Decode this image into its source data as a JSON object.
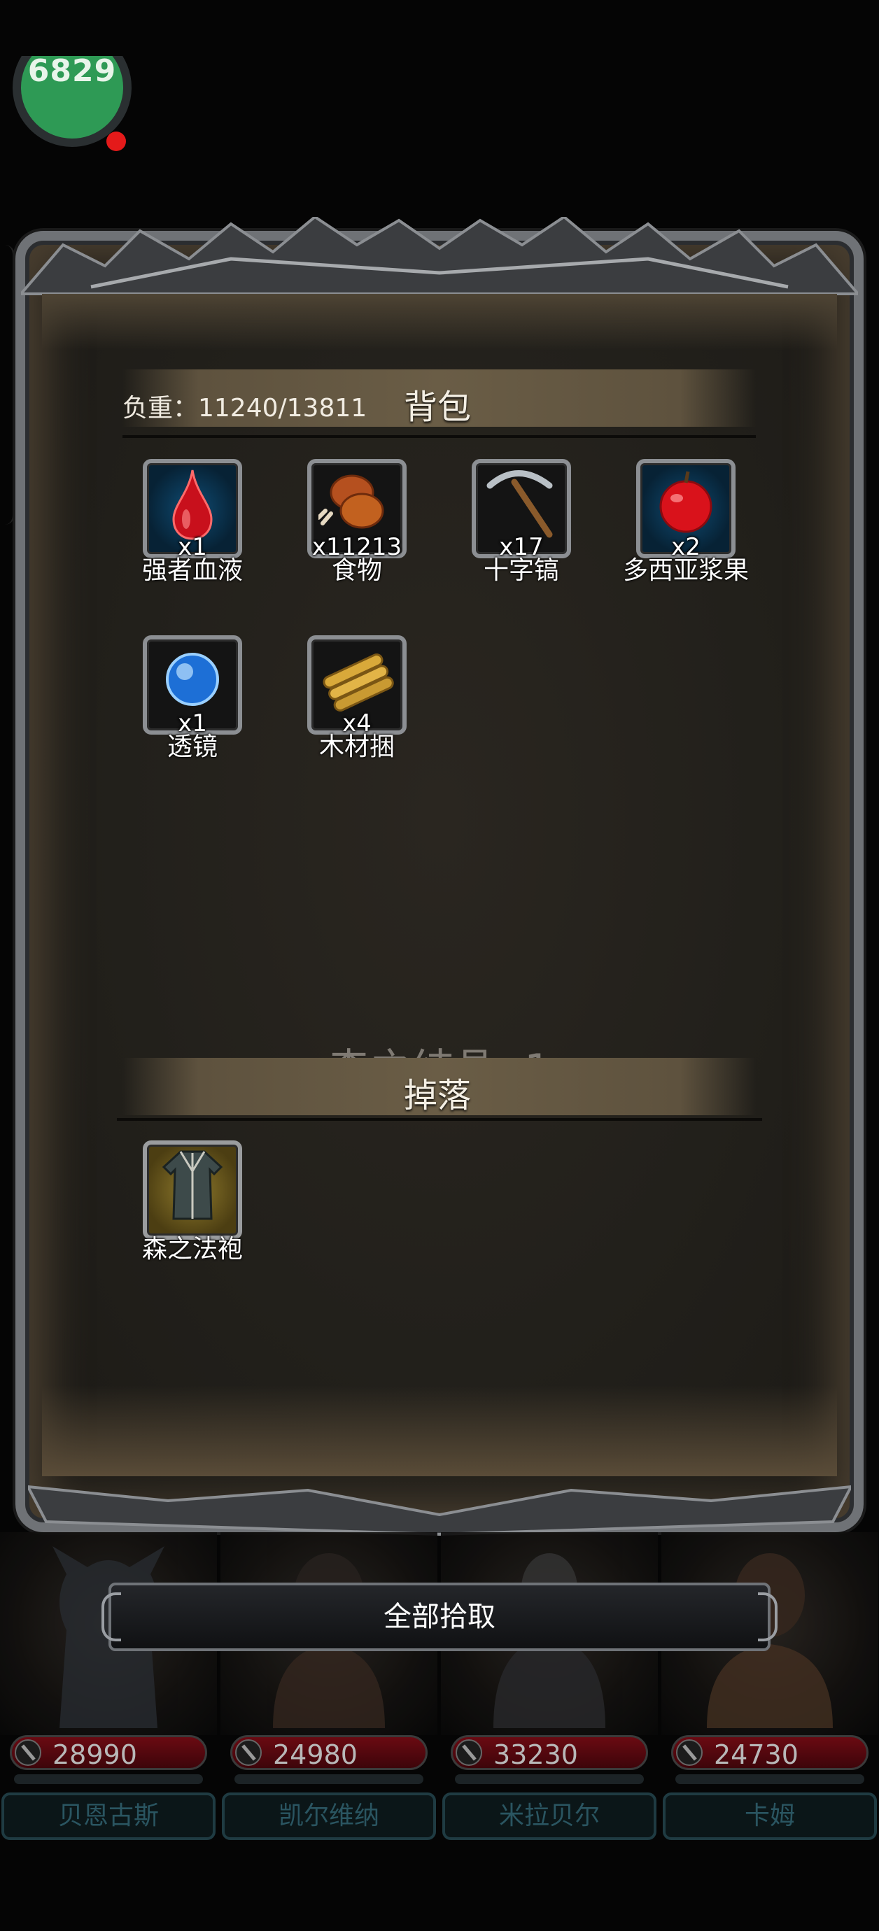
{
  "timer": {
    "value": "6829"
  },
  "inventory": {
    "weight_label": "负重：11240/13811",
    "title": "背包",
    "items": [
      {
        "name": "强者血液",
        "qty": "x1",
        "icon": "blood-drop-icon"
      },
      {
        "name": "食物",
        "qty": "x11213",
        "icon": "meat-icon"
      },
      {
        "name": "十字镐",
        "qty": "x17",
        "icon": "pickaxe-icon"
      },
      {
        "name": "多西亚浆果",
        "qty": "x2",
        "icon": "apple-icon"
      },
      {
        "name": "透镜",
        "qty": "x1",
        "icon": "lens-orb-icon"
      },
      {
        "name": "木材捆",
        "qty": "x4",
        "icon": "wood-bundle-icon"
      }
    ]
  },
  "float_message": "森之结晶 -1",
  "drops": {
    "title": "掉落",
    "items": [
      {
        "name": "森之法袍",
        "qty": "",
        "icon": "robe-icon"
      }
    ]
  },
  "pick_all_label": "全部拾取",
  "heroes": [
    {
      "name": "贝恩古斯",
      "hp": "28990"
    },
    {
      "name": "凯尔维纳",
      "hp": "24980"
    },
    {
      "name": "米拉贝尔",
      "hp": "33230"
    },
    {
      "name": "卡姆",
      "hp": "24730"
    }
  ],
  "colors": {
    "hp_bar": "#6a0a12",
    "timer_green": "#2e9a55",
    "frame": "#6f7276"
  }
}
